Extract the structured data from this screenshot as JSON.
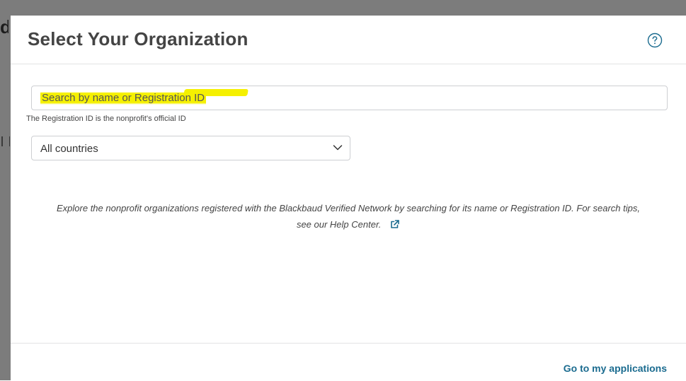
{
  "backdrop": {
    "partial_char": "d"
  },
  "modal": {
    "title": "Select Your Organization",
    "help_icon": "question-circle-icon",
    "search": {
      "placeholder": "Search by name or Registration ID",
      "value": "",
      "highlight_color": "#f5f000"
    },
    "helper_text": "The Registration ID is the nonprofit's official ID",
    "country_select": {
      "selected": "All countries",
      "icon": "chevron-down-icon"
    },
    "explore": {
      "text": "Explore the nonprofit organizations registered with the Blackbaud Verified Network by searching for its name or Registration ID. For search tips,",
      "link_text": "see our Help Center.",
      "link_icon": "external-link-icon"
    },
    "footer": {
      "link_text": "Go to my applications",
      "link_color": "#1a6b8f"
    }
  },
  "colors": {
    "title": "#444444",
    "accent": "#1a6b8f",
    "border": "#cdcfd2",
    "backdrop": "#7c7c7c"
  }
}
